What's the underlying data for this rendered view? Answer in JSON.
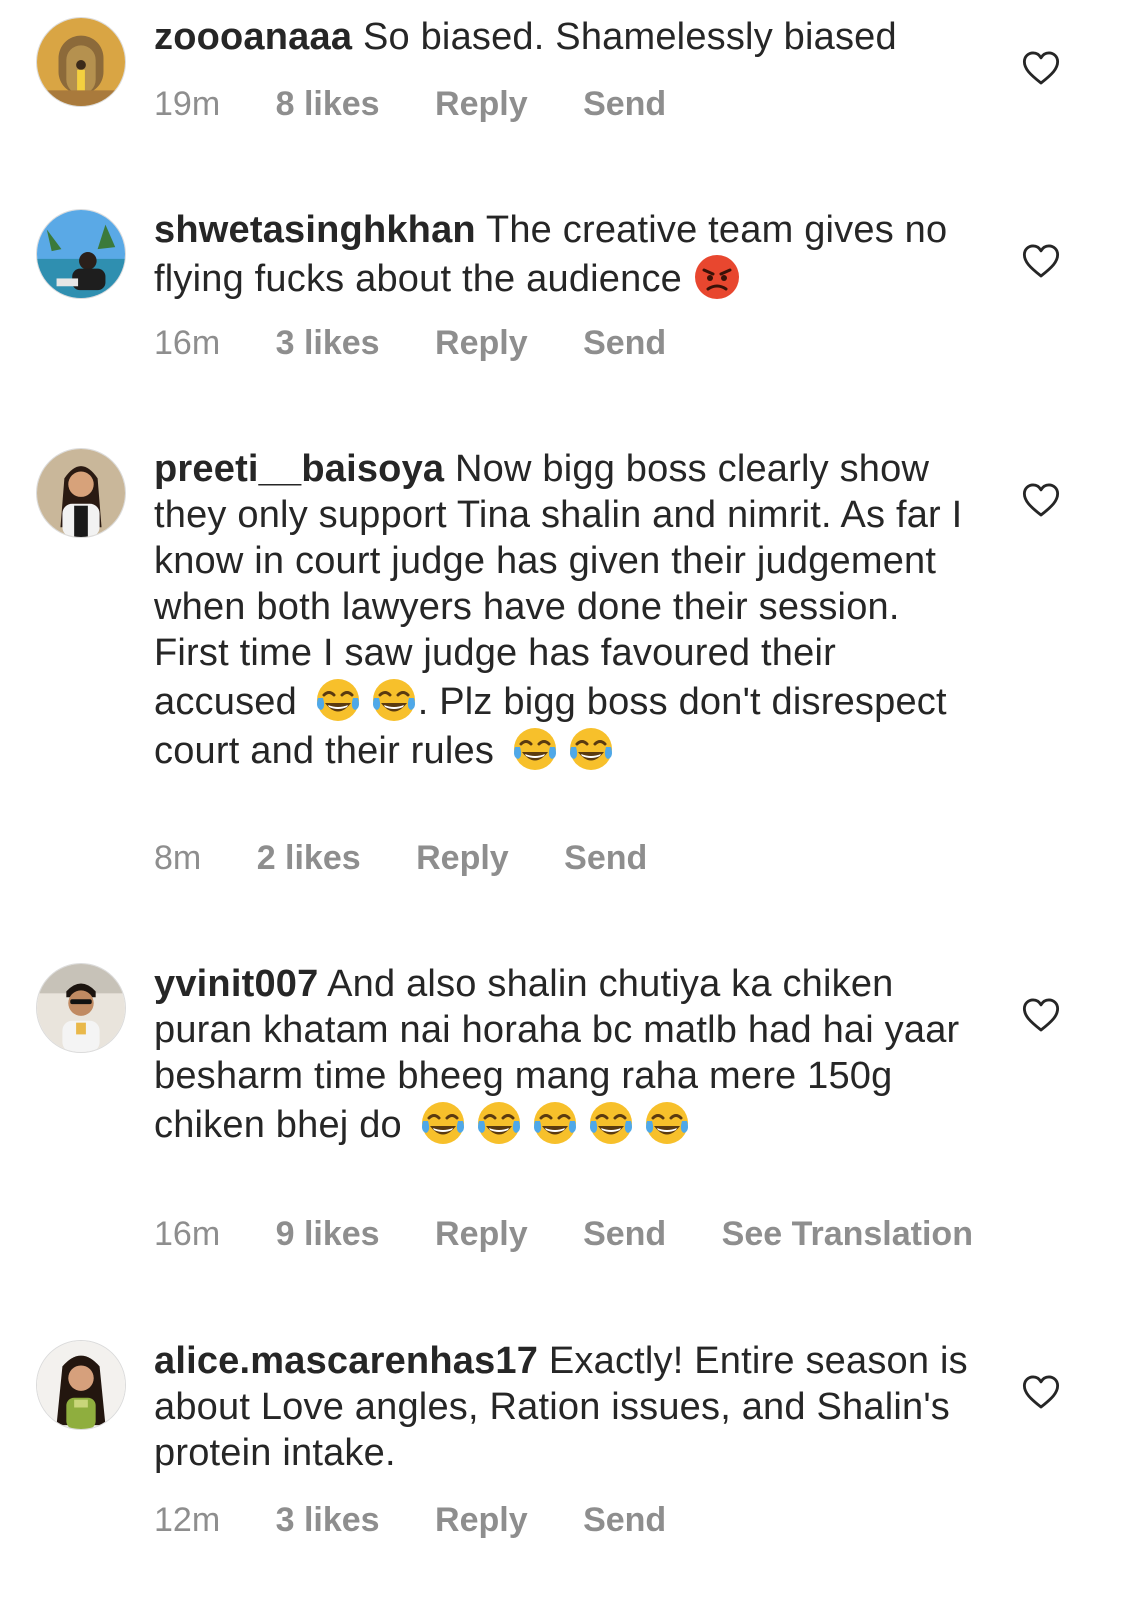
{
  "comments": [
    {
      "username": "zoooanaaa",
      "text": "So biased. Shamelessly biased",
      "time": "19m",
      "likes": "8 likes",
      "reply": "Reply",
      "send": "Send"
    },
    {
      "username": "shwetasinghkhan",
      "text": "The creative team gives no flying fucks about the audience",
      "time": "16m",
      "likes": "3 likes",
      "reply": "Reply",
      "send": "Send"
    },
    {
      "username": "preeti__baisoya",
      "text_part1": "Now bigg boss clearly show they only support Tina shalin and nimrit. As far I know in court judge has given their judgement when both lawyers have done their session. First time I saw judge has favoured their accused",
      "text_part2": ". Plz bigg boss don't disrespect court and their rules",
      "time": "8m",
      "likes": "2 likes",
      "reply": "Reply",
      "send": "Send"
    },
    {
      "username": "yvinit007",
      "text": "And also  shalin chutiya  ka chiken puran khatam nai horaha bc  matlb had hai yaar besharm time bheeg mang raha mere 150g chiken bhej do",
      "time": "16m",
      "likes": "9 likes",
      "reply": "Reply",
      "send": "Send",
      "see_translation": "See Translation"
    },
    {
      "username": "alice.mascarenhas17",
      "text": "Exactly! Entire season is about Love angles, Ration issues, and Shalin's protein intake.",
      "time": "12m",
      "likes": "3 likes",
      "reply": "Reply",
      "send": "Send"
    }
  ],
  "icons": {
    "like": "heart-outline-icon",
    "angry": "angry-face-emoji",
    "laugh": "tears-of-joy-emoji"
  },
  "colors": {
    "text": "#262626",
    "meta": "#8e8e8e",
    "emoji_yellow": "#f7c02b",
    "emoji_angry": "#e8472f"
  }
}
